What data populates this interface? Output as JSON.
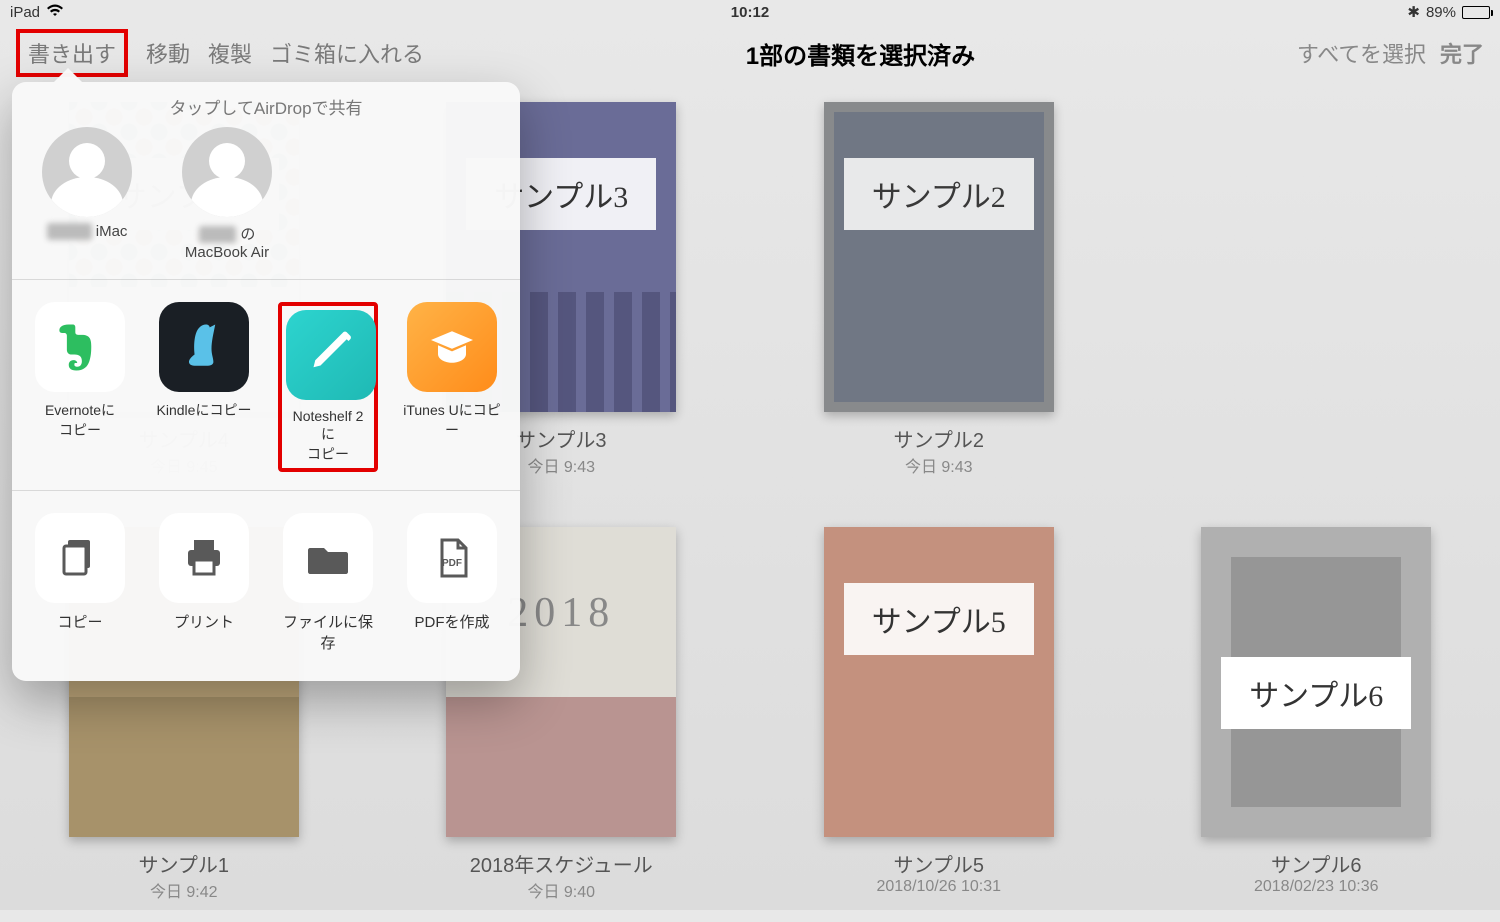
{
  "status": {
    "device": "iPad",
    "time": "10:12",
    "battery_pct": "89%"
  },
  "toolbar": {
    "export": "書き出す",
    "move": "移動",
    "duplicate": "複製",
    "trash": "ゴミ箱に入れる",
    "title": "1部の書類を選択済み",
    "select_all": "すべてを選択",
    "done": "完了"
  },
  "docs": [
    {
      "cover_text": "サンプル4",
      "title": "サンプル4",
      "sub": "今日 9:45",
      "cov": "cov4"
    },
    {
      "cover_text": "サンプル3",
      "title": "サンプル3",
      "sub": "今日 9:43",
      "cov": "cov3"
    },
    {
      "cover_text": "サンプル2",
      "title": "サンプル2",
      "sub": "今日 9:43",
      "cov": "cov2",
      "selected": true
    },
    {
      "cover_text": "",
      "title": "サンプル1",
      "sub": "今日 9:42",
      "cov": "cov1"
    },
    {
      "cover_text": "2018",
      "title": "2018年スケジュール",
      "sub": "今日 9:40",
      "cov": "cov-sched"
    },
    {
      "cover_text": "サンプル5",
      "title": "サンプル5",
      "sub": "2018/10/26 10:31",
      "cov": "cov5"
    },
    {
      "cover_text": "サンプル6",
      "title": "サンプル6",
      "sub": "2018/02/23 10:36",
      "cov": "cov6"
    }
  ],
  "share": {
    "airdrop_title": "タップしてAirDropで共有",
    "airdrop": [
      {
        "name_suffix": "iMac"
      },
      {
        "name_suffix": "の",
        "line2": "MacBook Air"
      }
    ],
    "apps": [
      {
        "label": "Evernoteに",
        "label2": "コピー",
        "cls": "ic-evernote"
      },
      {
        "label": "Kindleにコピー",
        "cls": "ic-kindle"
      },
      {
        "label": "Noteshelf 2に",
        "label2": "コピー",
        "cls": "ic-noteshelf",
        "highlight": true
      },
      {
        "label": "iTunes Uにコピー",
        "cls": "ic-itunesu"
      }
    ],
    "actions": [
      {
        "label": "コピー",
        "icon": "copy"
      },
      {
        "label": "プリント",
        "icon": "print"
      },
      {
        "label": "ファイルに保存",
        "icon": "folder"
      },
      {
        "label": "PDFを作成",
        "icon": "pdf"
      }
    ]
  }
}
